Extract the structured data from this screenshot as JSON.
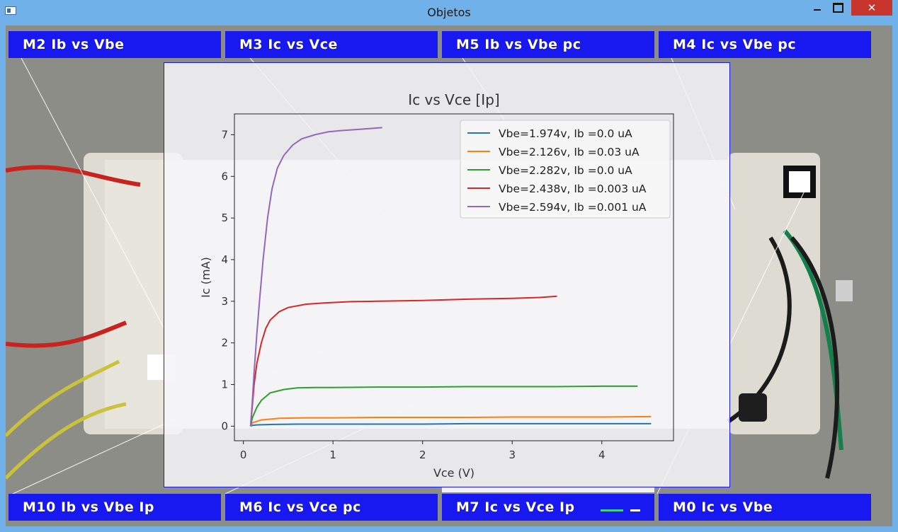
{
  "window": {
    "title": "Objetos",
    "close_glyph": "✕"
  },
  "tabs_top": [
    "M2  Ib vs Vbe",
    "M3  Ic vs Vce",
    "M5  Ib vs Vbe pc",
    "M4  Ic vs Vbe pc"
  ],
  "tabs_bottom": [
    "M10  Ib vs Vbe Ip",
    "M6  Ic vs Vce pc",
    "M7  Ic vs Vce Ip",
    "M0  Ic vs Vbe"
  ],
  "colors": {
    "tab_bg": "#1818f0",
    "window_frame": "#6fb1e8",
    "close_btn": "#c7352c"
  },
  "chart_data": {
    "type": "line",
    "title": "Ic vs Vce [Ip]",
    "xlabel": "Vce (V)",
    "ylabel": "Ic (mA)",
    "xlim": [
      -0.1,
      4.8
    ],
    "ylim": [
      -0.35,
      7.5
    ],
    "xticks": [
      0,
      1,
      2,
      3,
      4
    ],
    "yticks": [
      0,
      1,
      2,
      3,
      4,
      5,
      6,
      7
    ],
    "legend_position": "top-right",
    "series": [
      {
        "name": "Vbe=1.974v, Ib =0.0 uA",
        "color": "#1f77b4",
        "x": [
          0.08,
          0.1,
          0.15,
          0.3,
          0.6,
          1.0,
          1.5,
          2.0,
          2.5,
          3.0,
          3.5,
          4.0,
          4.55
        ],
        "y": [
          0.0,
          0.02,
          0.03,
          0.04,
          0.05,
          0.05,
          0.05,
          0.05,
          0.06,
          0.06,
          0.06,
          0.06,
          0.06
        ]
      },
      {
        "name": "Vbe=2.126v, Ib =0.03 uA",
        "color": "#ff7f0e",
        "x": [
          0.08,
          0.1,
          0.2,
          0.4,
          0.7,
          1.0,
          1.5,
          2.0,
          2.5,
          3.0,
          3.5,
          4.0,
          4.55
        ],
        "y": [
          0.0,
          0.08,
          0.15,
          0.19,
          0.2,
          0.2,
          0.21,
          0.21,
          0.21,
          0.22,
          0.22,
          0.22,
          0.23
        ]
      },
      {
        "name": "Vbe=2.282v, Ib =0.0 uA",
        "color": "#2ca02c",
        "x": [
          0.08,
          0.1,
          0.15,
          0.2,
          0.3,
          0.45,
          0.6,
          0.8,
          1.0,
          1.5,
          2.0,
          2.5,
          3.0,
          3.5,
          4.0,
          4.4
        ],
        "y": [
          0.0,
          0.2,
          0.45,
          0.62,
          0.8,
          0.88,
          0.92,
          0.93,
          0.93,
          0.94,
          0.94,
          0.95,
          0.95,
          0.95,
          0.96,
          0.96
        ]
      },
      {
        "name": "Vbe=2.438v, Ib =0.003 uA",
        "color": "#d62728",
        "x": [
          0.08,
          0.1,
          0.12,
          0.15,
          0.2,
          0.25,
          0.3,
          0.4,
          0.5,
          0.7,
          0.9,
          1.2,
          1.5,
          2.0,
          2.5,
          3.0,
          3.3,
          3.5
        ],
        "y": [
          0.0,
          0.5,
          1.0,
          1.5,
          2.0,
          2.35,
          2.55,
          2.75,
          2.85,
          2.93,
          2.96,
          2.99,
          3.0,
          3.02,
          3.05,
          3.07,
          3.09,
          3.12
        ]
      },
      {
        "name": "Vbe=2.594v, Ib =0.001 uA",
        "color": "#9467bd",
        "x": [
          0.08,
          0.1,
          0.12,
          0.15,
          0.18,
          0.22,
          0.27,
          0.32,
          0.38,
          0.45,
          0.55,
          0.65,
          0.8,
          0.95,
          1.1,
          1.3,
          1.55
        ],
        "y": [
          0.0,
          0.6,
          1.3,
          2.2,
          3.0,
          4.0,
          5.0,
          5.7,
          6.2,
          6.5,
          6.75,
          6.9,
          7.0,
          7.07,
          7.1,
          7.13,
          7.17
        ]
      }
    ]
  }
}
